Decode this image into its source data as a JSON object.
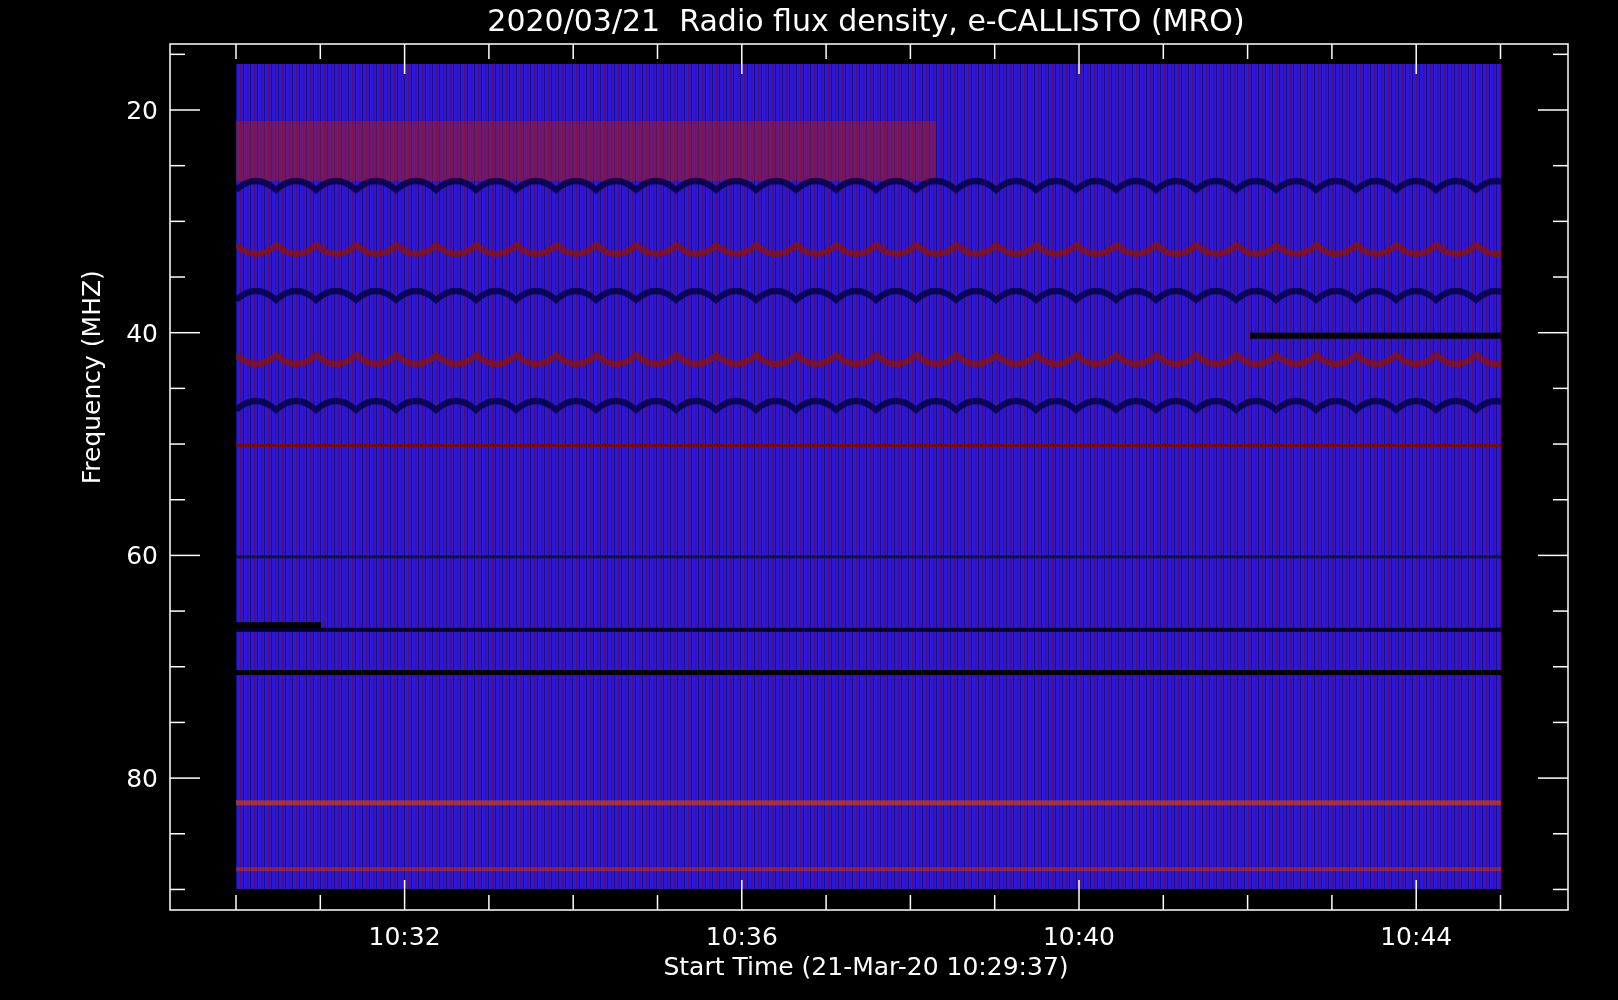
{
  "title": "2020/03/21  Radio flux density, e-CALLISTO (MRO)",
  "y_axis": {
    "label": "Frequency (MHZ)",
    "ticks": [
      "20",
      "40",
      "60",
      "80"
    ]
  },
  "x_axis": {
    "label": "Start Time (21-Mar-20 10:29:37)",
    "ticks": [
      "10:32",
      "10:36",
      "10:40",
      "10:44"
    ]
  }
}
